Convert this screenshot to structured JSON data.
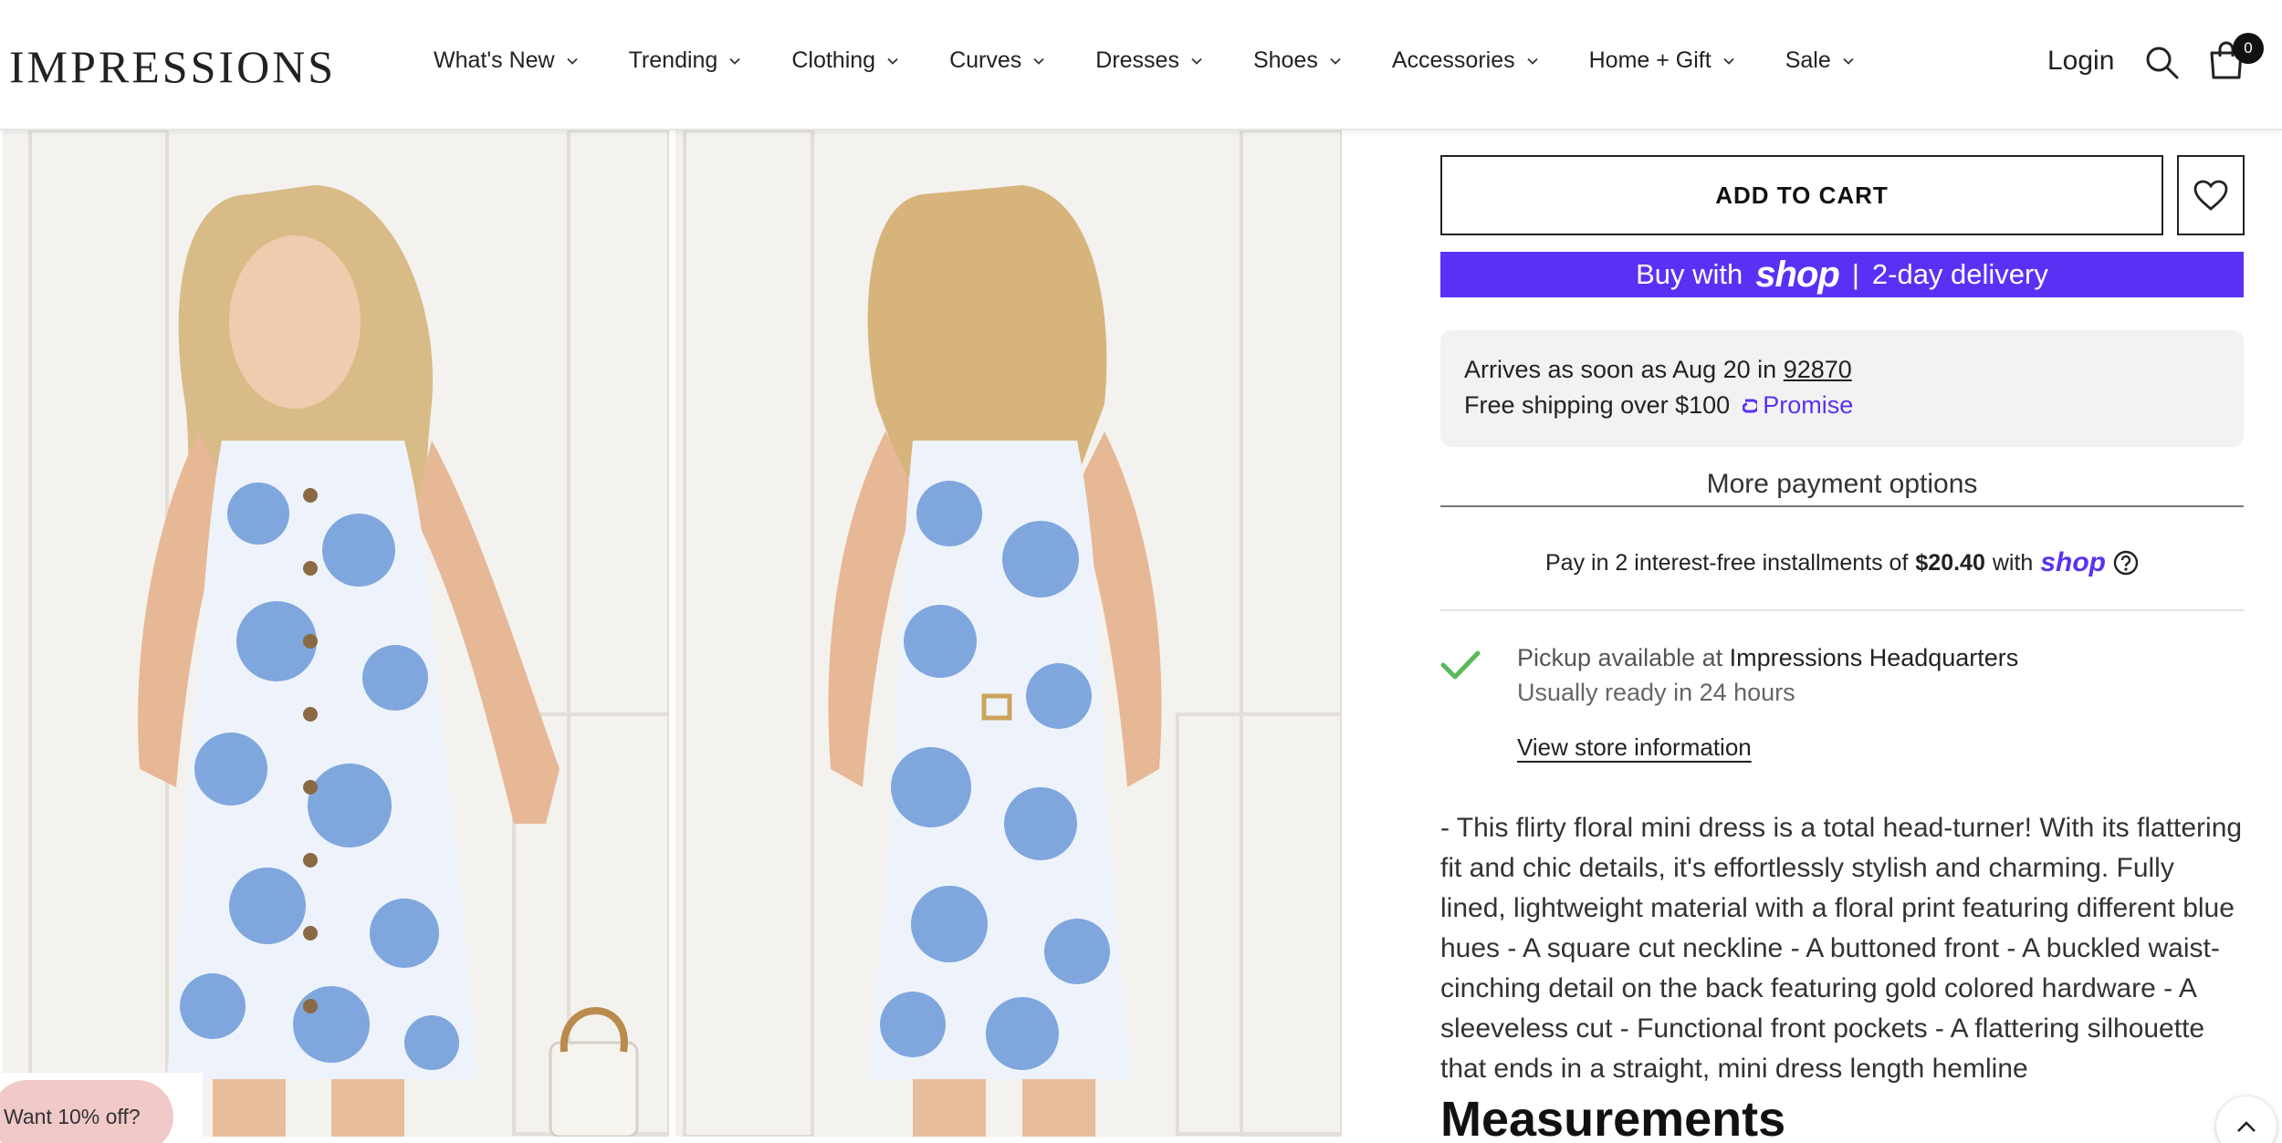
{
  "brand": {
    "logo_text": "IMPRESSIONS"
  },
  "nav": {
    "items": [
      {
        "label": "What's New"
      },
      {
        "label": "Trending"
      },
      {
        "label": "Clothing"
      },
      {
        "label": "Curves"
      },
      {
        "label": "Dresses"
      },
      {
        "label": "Shoes"
      },
      {
        "label": "Accessories"
      },
      {
        "label": "Home + Gift"
      },
      {
        "label": "Sale"
      }
    ],
    "login_label": "Login",
    "cart_count": "0"
  },
  "product": {
    "add_to_cart_label": "ADD TO CART",
    "shop_pay": {
      "prefix": "Buy with",
      "brand": "shop",
      "separator": "|",
      "suffix": "2-day delivery"
    },
    "delivery": {
      "arrives_prefix": "Arrives as soon as Aug 20 in",
      "zip": "92870",
      "free_shipping": "Free shipping over $100",
      "promise_label": "Promise"
    },
    "more_payment_options": "More payment options",
    "installments": {
      "prefix": "Pay in 2 interest-free installments of",
      "amount": "$20.40",
      "with": "with",
      "brand": "shop"
    },
    "pickup": {
      "available_at": "Pickup available at",
      "store": "Impressions Headquarters",
      "ready": "Usually ready in 24 hours",
      "view_store": "View store information"
    },
    "description": "- This flirty floral mini dress is a total head-turner! With its flattering fit and chic details, it's effortlessly stylish and charming. Fully lined, lightweight material with a floral print featuring different blue hues - A square cut neckline - A buttoned front - A buckled waist-cinching detail on the back featuring gold colored hardware - A sleeveless cut - Functional front pockets - A flattering silhouette that ends in a straight, mini dress length hemline",
    "measurements_heading": "Measurements"
  },
  "popup": {
    "label": "Want 10% off?"
  },
  "colors": {
    "accent": "#5a31f4",
    "check": "#5ab85a",
    "popup": "#f1c9c9"
  }
}
